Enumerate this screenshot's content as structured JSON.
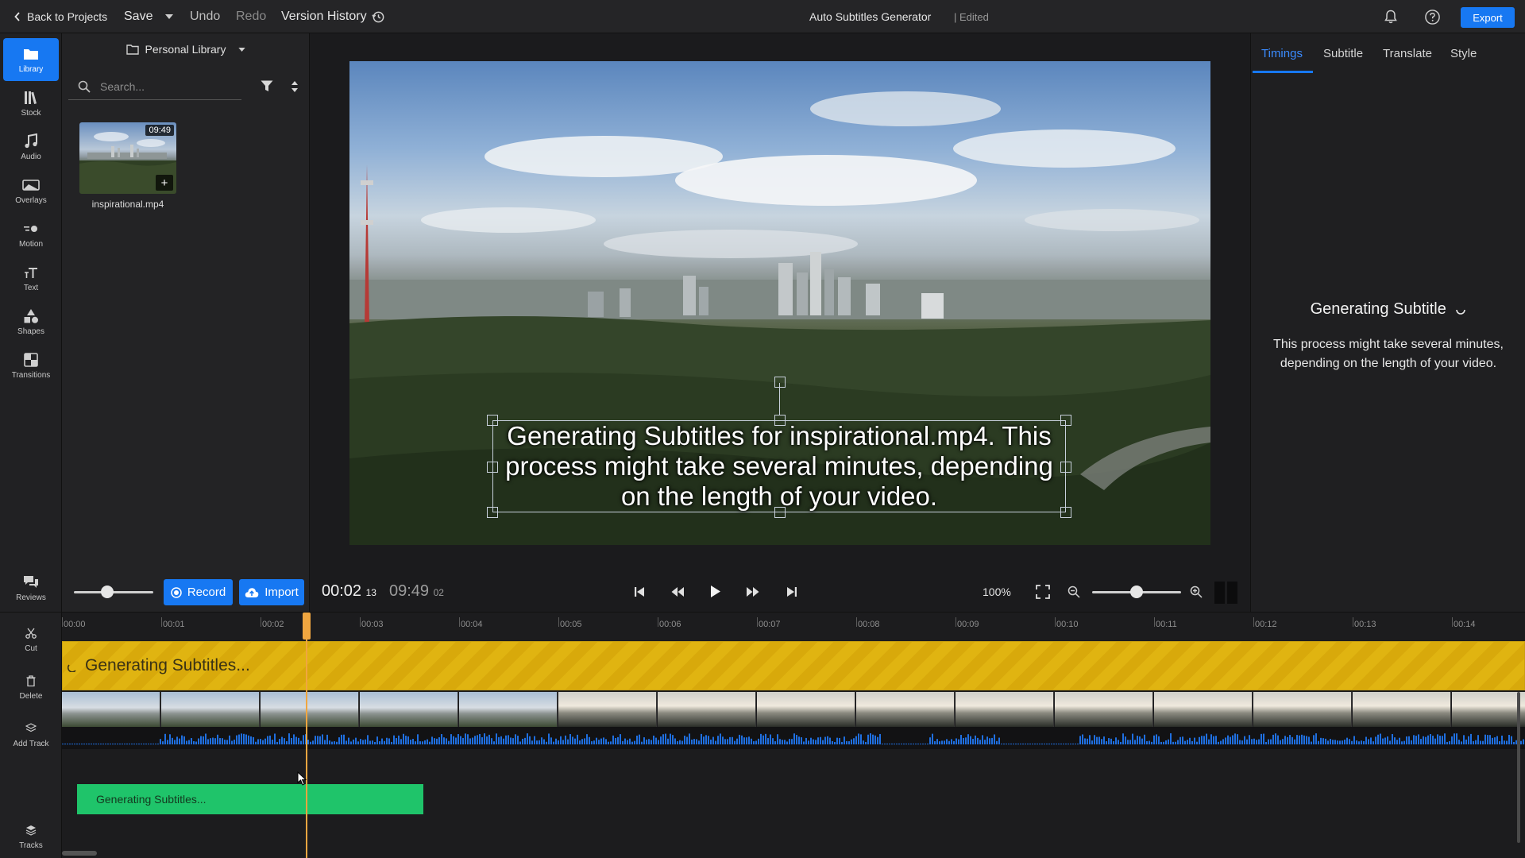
{
  "topbar": {
    "back_label": "Back to Projects",
    "save_label": "Save",
    "undo_label": "Undo",
    "redo_label": "Redo",
    "version_history_label": "Version History",
    "project_title": "Auto Subtitles Generator",
    "edited_status": "| Edited",
    "export_label": "Export",
    "icons": [
      "chevron-left-icon",
      "chevron-down-icon",
      "history-icon",
      "bell-icon",
      "help-icon"
    ]
  },
  "sidebar": {
    "items": [
      {
        "label": "Library",
        "icon": "folder-icon"
      },
      {
        "label": "Stock",
        "icon": "stock-icon"
      },
      {
        "label": "Audio",
        "icon": "music-note-icon"
      },
      {
        "label": "Overlays",
        "icon": "overlay-icon"
      },
      {
        "label": "Motion",
        "icon": "motion-icon"
      },
      {
        "label": "Text",
        "icon": "text-icon"
      },
      {
        "label": "Shapes",
        "icon": "shapes-icon"
      },
      {
        "label": "Transitions",
        "icon": "transitions-icon"
      }
    ],
    "reviews_label": "Reviews"
  },
  "library": {
    "header_label": "Personal Library",
    "search_placeholder": "Search...",
    "media": [
      {
        "name": "inspirational.mp4",
        "duration": "09:49"
      }
    ]
  },
  "preview": {
    "subtitle_text": "Generating Subtitles for  inspirational.mp4. This process might take several minutes, depending on the length of your video."
  },
  "controls": {
    "record_label": "Record",
    "import_label": "Import",
    "current_time": "00:02",
    "current_frame": "13",
    "total_time": "09:49",
    "total_frame": "02",
    "zoom_label": "100%",
    "volume_level": 0.4,
    "timeline_zoom_level": 0.5
  },
  "right_panel": {
    "tabs": [
      "Timings",
      "Subtitle",
      "Translate",
      "Style"
    ],
    "active_tab": "Timings",
    "generating_title": "Generating Subtitle",
    "generating_desc": "This process might take several minutes, depending on the length of your video."
  },
  "timeline": {
    "tools": [
      {
        "label": "Cut",
        "icon": "scissors-icon"
      },
      {
        "label": "Delete",
        "icon": "trash-icon"
      },
      {
        "label": "Add Track",
        "icon": "add-track-icon"
      },
      {
        "label": "Tracks",
        "icon": "layers-icon"
      }
    ],
    "ruler_labels": [
      "00:00",
      "00:01",
      "00:02",
      "00:03",
      "00:04",
      "00:05",
      "00:06",
      "00:07",
      "00:08",
      "00:09",
      "00:10",
      "00:11",
      "00:12",
      "00:13",
      "00:14"
    ],
    "subtitle_track_label": "Generating Subtitles...",
    "green_clip_label": "Generating Subtitles..."
  },
  "colors": {
    "accent": "#1778f2",
    "subtitle_track": "#e0b411",
    "green_clip": "#1fc46a",
    "playhead": "#f0a640"
  }
}
